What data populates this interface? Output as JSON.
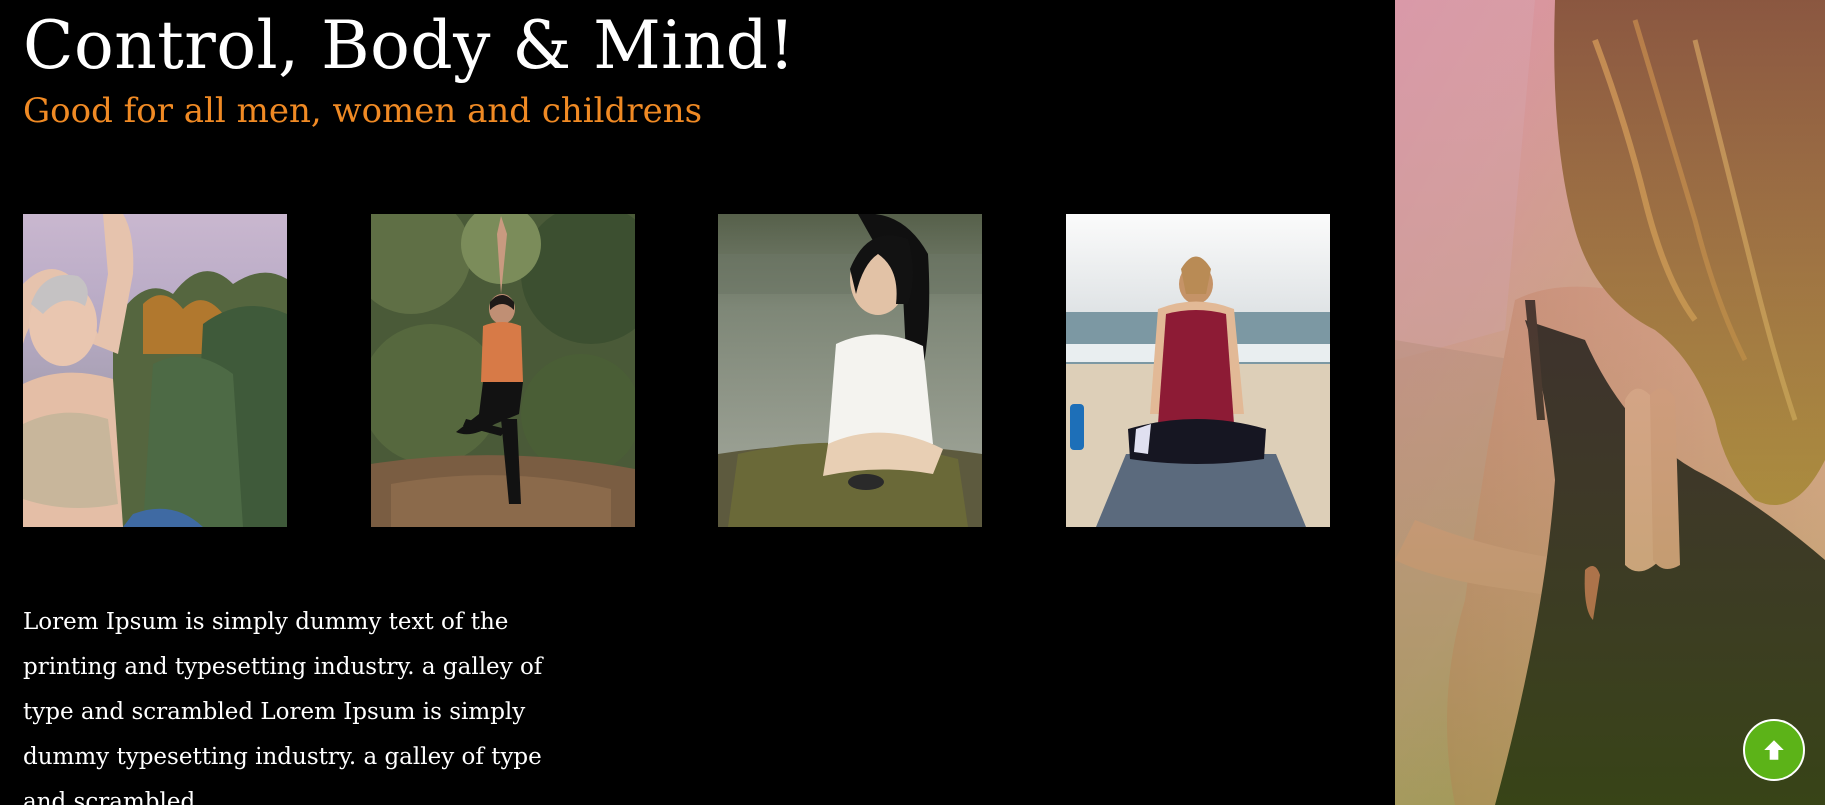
{
  "hero": {
    "title": "Control, Body & Mind!",
    "subtitle": "Good for all men, women and childrens"
  },
  "gallery": {
    "items": [
      {
        "name": "woman-arms-raised-forest"
      },
      {
        "name": "woman-tree-pose-forest"
      },
      {
        "name": "woman-meditating-lake"
      },
      {
        "name": "woman-meditating-beach"
      }
    ]
  },
  "description": "Lorem Ipsum is simply dummy text of the printing and typesetting industry. a galley of type and scrambled Lorem Ipsum is simply dummy typesetting industry. a galley of type and scrambled",
  "side_image": {
    "name": "woman-reverse-prayer-pose"
  },
  "scroll_top": {
    "icon": "arrow-up-icon",
    "color": "#5cb318"
  },
  "colors": {
    "background": "#000000",
    "heading": "#ffffff",
    "subheading": "#f08a24",
    "accent": "#5cb318"
  }
}
